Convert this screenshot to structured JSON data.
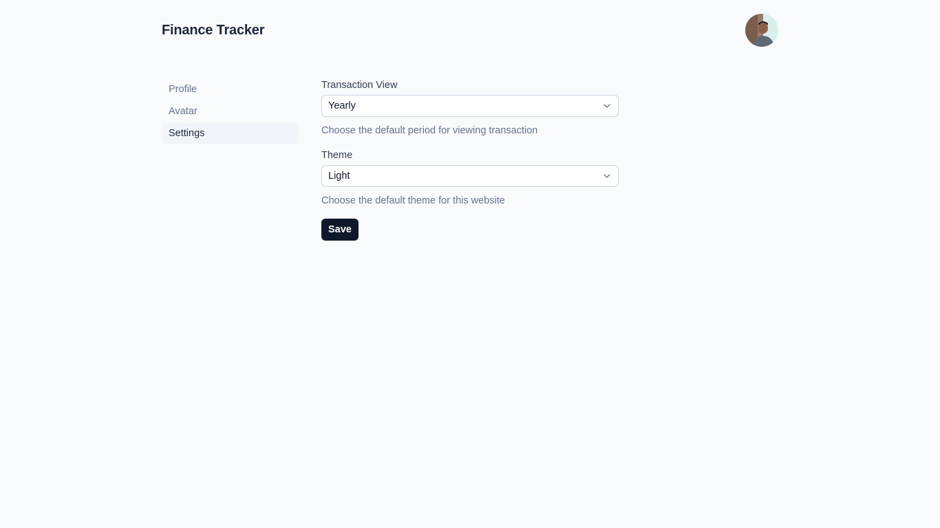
{
  "header": {
    "title": "Finance Tracker",
    "avatar_icon": "user-avatar"
  },
  "sidebar": {
    "items": [
      {
        "label": "Profile",
        "active": false
      },
      {
        "label": "Avatar",
        "active": false
      },
      {
        "label": "Settings",
        "active": true
      }
    ]
  },
  "settings": {
    "transaction_view": {
      "label": "Transaction View",
      "value": "Yearly",
      "help": "Choose the default period for viewing transaction"
    },
    "theme": {
      "label": "Theme",
      "value": "Light",
      "help": "Choose the default theme for this website"
    },
    "save_label": "Save"
  },
  "colors": {
    "background": "#f8fafc",
    "primary_button": "#0f172a",
    "active_nav": "#f1f5f9",
    "muted_text": "#64748b"
  }
}
